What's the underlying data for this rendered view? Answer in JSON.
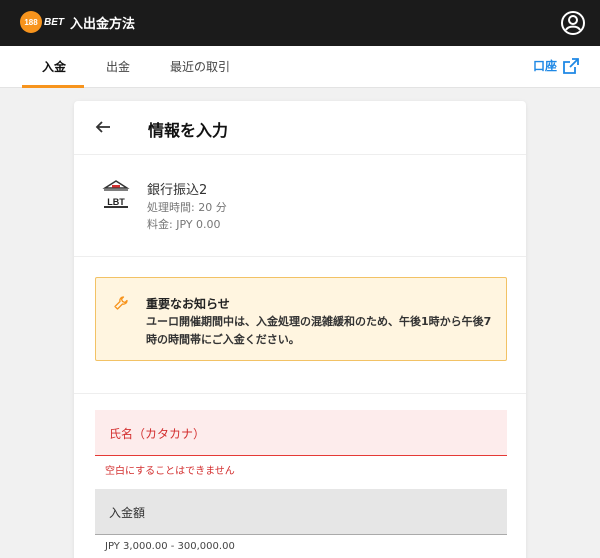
{
  "topbar": {
    "logo_number": "188",
    "logo_text": "BET",
    "title": "入出金方法"
  },
  "tabs": [
    {
      "label": "入金",
      "active": true
    },
    {
      "label": "出金",
      "active": false
    },
    {
      "label": "最近の取引",
      "active": false
    }
  ],
  "account_link": {
    "label": "口座",
    "icon": "external-link-icon"
  },
  "card": {
    "title": "情報を入力"
  },
  "method": {
    "icon_text": "LBT",
    "name": "銀行振込2",
    "processing_time": "処理時間: 20 分",
    "fee": "料金: JPY 0.00"
  },
  "notice": {
    "title": "重要なお知らせ",
    "body": "ユーロ開催期間中は、入金処理の混雑緩和のため、午後1時から午後7時の時間帯にご入金ください。"
  },
  "form": {
    "name_label": "氏名（カタカナ）",
    "name_error": "空白にすることはできません",
    "amount_label": "入金額",
    "amount_range": "JPY 3,000.00 - 300,000.00"
  },
  "colors": {
    "accent": "#f7941d",
    "link": "#1e88e5",
    "error": "#d32f2f",
    "notice_bg": "#fff5e0",
    "notice_border": "#f2c265"
  }
}
